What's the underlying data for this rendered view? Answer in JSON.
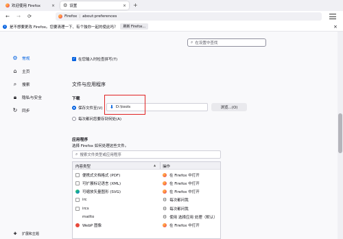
{
  "tabs": [
    {
      "label": "欢迎使用 Firefox",
      "close": "×"
    },
    {
      "label": "设置",
      "close": "×"
    }
  ],
  "new_tab": "+",
  "urlbar": {
    "browser": "Firefox",
    "url": "about:preferences"
  },
  "nav": {
    "back": "←",
    "forward": "→",
    "reload": "⟳"
  },
  "notification": {
    "text": "是不想要更改 Firefox。您要清理一下、有个独你一起的使此吗？",
    "button": "刷新 Firefox..."
  },
  "search_pref": {
    "placeholder": "在设置中查找"
  },
  "sidebar": {
    "items": [
      {
        "label": "常规",
        "icon": "gear-icon"
      },
      {
        "label": "主页",
        "icon": "home-icon"
      },
      {
        "label": "搜索",
        "icon": "search-icon"
      },
      {
        "label": "隐私与安全",
        "icon": "lock-icon"
      },
      {
        "label": "同步",
        "icon": "sync-icon"
      }
    ],
    "bottom": [
      {
        "label": "扩展和主题",
        "icon": "puzzle-icon"
      }
    ]
  },
  "spellcheck": {
    "label": "在您输入时检查拼写(T)",
    "checked": true
  },
  "files_apps": {
    "title": "文件与应用程序",
    "downloads": {
      "title": "下载",
      "save_to_label": "保存文件至(V)",
      "folder": "D:\\tools",
      "browse_button": "浏览...(O)",
      "ask_label": "每次都问您要存到何处(A)"
    },
    "apps": {
      "title": "应用程序",
      "desc": "选择 Firefox 如何处理这些文件。",
      "search_placeholder": "搜索文件类型或应用程序",
      "col_type": "内容类型",
      "col_action": "操作",
      "sort_icon": "▲",
      "rows": [
        {
          "type": "便携式文档格式 (PDF)",
          "action": "在 Firefox 中打开",
          "type_icon": "doc",
          "action_icon": "fx"
        },
        {
          "type": "可扩展标记语言 (XML)",
          "action": "在 Firefox 中打开",
          "type_icon": "doc",
          "action_icon": "fx"
        },
        {
          "type": "可缩放矢量图形 (SVG)",
          "action": "在 Firefox 中打开",
          "type_icon": "edge",
          "action_icon": "fx"
        },
        {
          "type": "irc",
          "action": "每次都问我",
          "type_icon": "doc",
          "action_icon": "gear"
        },
        {
          "type": "ircs",
          "action": "每次都问我",
          "type_icon": "doc",
          "action_icon": "gear"
        },
        {
          "type": "mailto",
          "action": "使用 选择应用 处理（默认）",
          "type_icon": "none",
          "action_icon": "gear"
        },
        {
          "type": "WebP 图像",
          "action": "在 Firefox 中打开",
          "type_icon": "red",
          "action_icon": "fx"
        }
      ]
    }
  }
}
